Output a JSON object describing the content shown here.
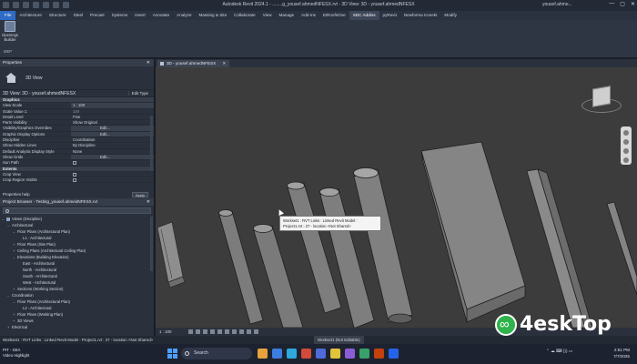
{
  "window": {
    "title": "Autodesk Revit 2024.1 - ........g_yousef.ahmedNFESX.rvt - 3D View: 3D - yousef.ahmedNFESX",
    "user": "yousef.ahme...",
    "controls": [
      "—",
      "▢",
      "✕"
    ]
  },
  "ribbon_tabs": [
    "File",
    "Architecture",
    "Structure",
    "Steel",
    "Precast",
    "Systems",
    "Insert",
    "Annotate",
    "Analyze",
    "Massing & Site",
    "Collaborate",
    "View",
    "Manage",
    "Add-Ins",
    "EiRoofsOne",
    "SDC Addins",
    "pyRevit",
    "Newforma Konekt",
    "Modify"
  ],
  "active_tab": "SDC Addins",
  "ribbon": {
    "button_label": "Openings Builder",
    "panel_label": "MEP"
  },
  "properties": {
    "header": "Properties",
    "type_name": "3D View",
    "instance": "3D View: 3D - yousef.ahmedNFESX",
    "edit_type": "Edit Type",
    "rows": [
      {
        "k": "Graphics",
        "v": "",
        "section": true
      },
      {
        "k": "View Scale",
        "v": "1 : 100",
        "box": true
      },
      {
        "k": "Scale Value  1:",
        "v": "100",
        "grey": true
      },
      {
        "k": "Detail Level",
        "v": "Fine"
      },
      {
        "k": "Parts Visibility",
        "v": "Show Original"
      },
      {
        "k": "Visibility/Graphics Overrides",
        "v": "Edit...",
        "box": true,
        "button": true
      },
      {
        "k": "Graphic Display Options",
        "v": "Edit...",
        "box": true,
        "button": true
      },
      {
        "k": "Discipline",
        "v": "Coordination"
      },
      {
        "k": "Show Hidden Lines",
        "v": "By Discipline"
      },
      {
        "k": "Default Analysis Display Style",
        "v": "None"
      },
      {
        "k": "Show Grids",
        "v": "Edit...",
        "box": true,
        "button": true
      },
      {
        "k": "Sun Path",
        "v": "",
        "check": true
      },
      {
        "k": "Extents",
        "v": "",
        "section": true
      },
      {
        "k": "Crop View",
        "v": "",
        "check": true
      },
      {
        "k": "Crop Region Visible",
        "v": "",
        "check": true
      }
    ],
    "help_link": "Properties help",
    "apply": "Apply"
  },
  "browser": {
    "header": "Project Browser - Testing_yousef.ahmedNFESX.rvt",
    "items": [
      {
        "label": "Views (Discipline)",
        "level": 0,
        "tog": "–"
      },
      {
        "label": "Architectural",
        "level": 1,
        "tog": "–"
      },
      {
        "label": "Floor Plans (Architectural Plan)",
        "level": 2,
        "tog": "–"
      },
      {
        "label": "L1 - Architectural",
        "level": 3,
        "tog": ""
      },
      {
        "label": "Floor Plans (Site Plan)",
        "level": 2,
        "tog": "+"
      },
      {
        "label": "Ceiling Plans (Architectural Ceiling Plan)",
        "level": 2,
        "tog": "+"
      },
      {
        "label": "Elevations (Building Elevation)",
        "level": 2,
        "tog": "–"
      },
      {
        "label": "East - Architectural",
        "level": 3,
        "tog": ""
      },
      {
        "label": "North - Architectural",
        "level": 3,
        "tog": ""
      },
      {
        "label": "South - Architectural",
        "level": 3,
        "tog": ""
      },
      {
        "label": "West - Architectural",
        "level": 3,
        "tog": ""
      },
      {
        "label": "Sections (Working Section)",
        "level": 2,
        "tog": "+"
      },
      {
        "label": "Coordination",
        "level": 1,
        "tog": "–"
      },
      {
        "label": "Floor Plans (Architectural Plan)",
        "level": 2,
        "tog": "–"
      },
      {
        "label": "L2 - Architectural",
        "level": 3,
        "tog": ""
      },
      {
        "label": "Floor Plans (Working Plan)",
        "level": 2,
        "tog": "+"
      },
      {
        "label": "3D Views",
        "level": 2,
        "tog": "+"
      },
      {
        "label": "Electrical",
        "level": 1,
        "tog": "+"
      }
    ]
  },
  "view_tab": {
    "label": "3D - yousef.ahmedNFESX",
    "close": "✕"
  },
  "tooltip": {
    "text": "Workset1 : RVT Links : Linked Revit Model : Project1.rvt : 27 - location <Not Shared>"
  },
  "view_control_bar": {
    "scale": "1 : 100"
  },
  "status_bar": {
    "left": "Workset1 : RVT Links : Linked Revit Model : Project1.rvt : 27 - location <Not Shared>",
    "workset": "Workset1 (Not Editable)"
  },
  "taskbar": {
    "app_name": "PIT - SEA",
    "app_sub": "Video Highlight",
    "search_placeholder": "Search",
    "time": "2:51 PM",
    "date": "7/7/2025",
    "app_colors": [
      "#e8a33d",
      "#3b7de0",
      "#2fa8e0",
      "#d24a3a",
      "#4f6bd8",
      "#e0c23b",
      "#8b5cd6",
      "#38a169",
      "#c2410c",
      "#2563eb"
    ]
  },
  "watermark": {
    "text": "4eskTop"
  }
}
